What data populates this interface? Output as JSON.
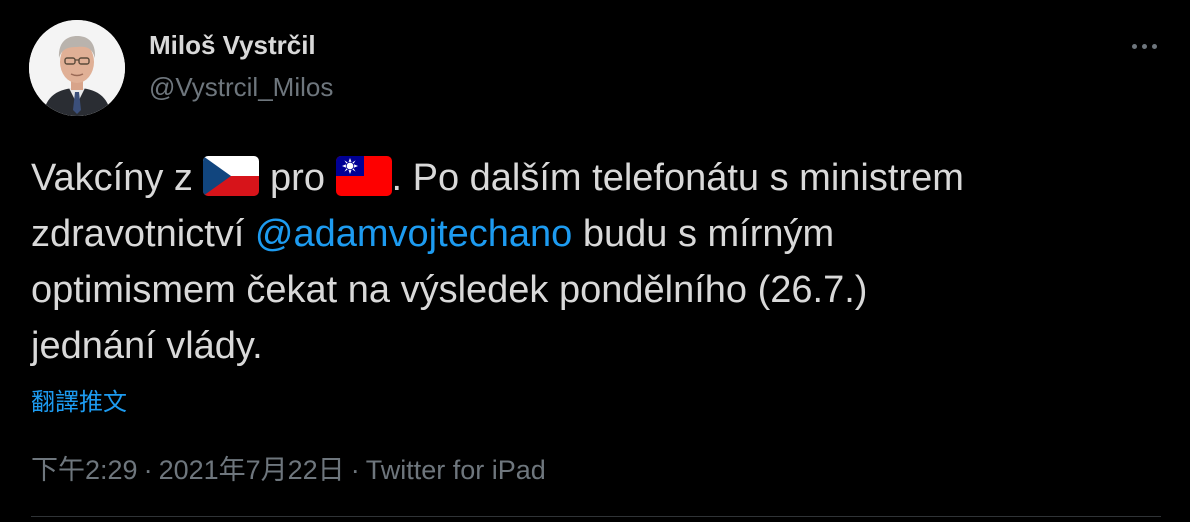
{
  "author": {
    "display_name": "Miloš Vystrčil",
    "handle": "@Vystrcil_Milos",
    "avatar_icon": "portrait-avatar"
  },
  "more_icon": "more-horizontal-icon",
  "tweet": {
    "line1": {
      "part1": "Vakcíny z ",
      "flag1": "czech-flag-emoji",
      "part2": " pro ",
      "flag2": "taiwan-flag-emoji",
      "part3": ". Po dalším telefonátu s ministrem"
    },
    "line2": {
      "part1": "zdravotnictví ",
      "mention": "@adamvojtechano",
      "part2": " budu s mírným"
    },
    "line3": "optimismem čekat na výsledek pondělního (26.7.)",
    "line4": "jednání vlády."
  },
  "translate_label": "翻譯推文",
  "meta": {
    "time": "下午2:29",
    "separator": "·",
    "date": "2021年7月22日",
    "source": "Twitter for iPad"
  },
  "colors": {
    "background": "#000000",
    "text": "#d9d9d9",
    "secondary": "#6e767d",
    "link": "#1d9bf0"
  }
}
